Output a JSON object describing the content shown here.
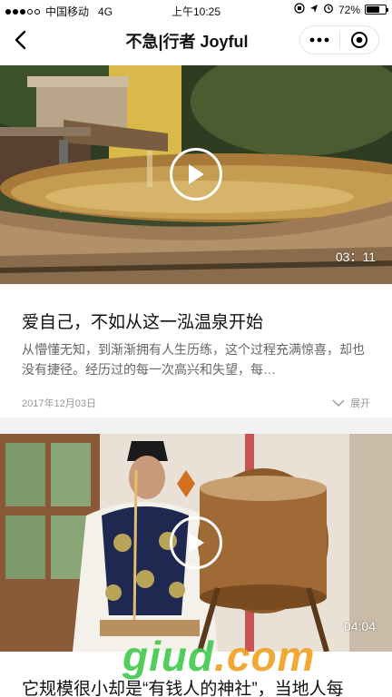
{
  "status_bar": {
    "carrier": "中国移动",
    "network": "4G",
    "time": "上午10:25",
    "battery": "72%",
    "battery_level": 0.72
  },
  "nav": {
    "title": "不急|行者 Joyful"
  },
  "articles": [
    {
      "duration": "03：11",
      "title": "爱自己，不如从这一泓温泉开始",
      "description": "从懵懂无知，到渐渐拥有人生历练，这个过程充满惊喜，却也没有捷径。经历过的每一次高兴和失望，每…",
      "date": "2017年12月03日",
      "expand_label": "展开"
    },
    {
      "duration": "04:04",
      "title": "它规模很小却是“有钱人的神社”，当地人每"
    }
  ],
  "watermark": {
    "main": "giud",
    "suffix": ".com"
  },
  "colors": {
    "divider": "#f2f2f2",
    "watermark_green": "#3fc94b",
    "watermark_orange": "#f0a020"
  }
}
